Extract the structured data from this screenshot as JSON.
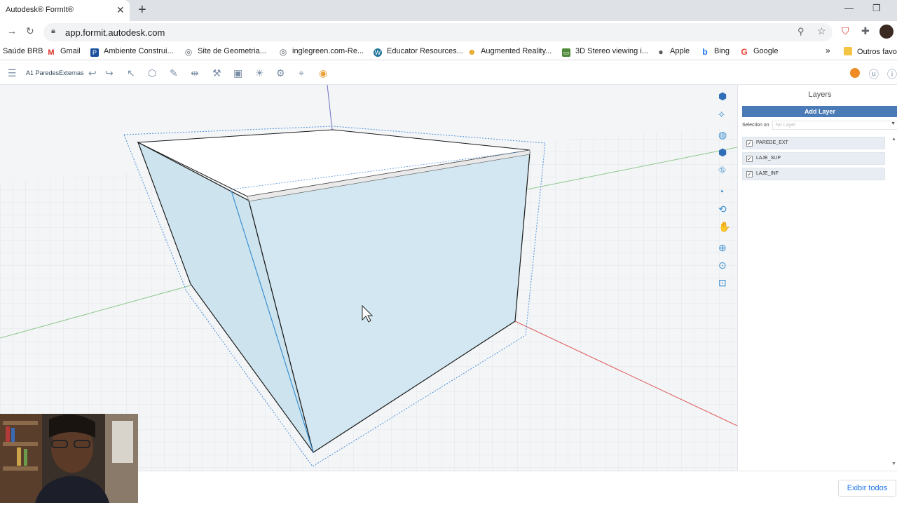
{
  "browser": {
    "tab_title": "Autodesk® FormIt®",
    "tab_close": "✕",
    "new_tab": "+",
    "url": "app.formit.autodesk.com",
    "bookmarks": [
      {
        "label": "Saúde BRB",
        "icon": "none"
      },
      {
        "label": "Gmail",
        "icon": "gmail-icon",
        "glyph": "M",
        "color": "#d93025"
      },
      {
        "label": "Ambiente Construi...",
        "icon": "p-icon",
        "glyph": "P",
        "color": "#1a4f9c"
      },
      {
        "label": "Site de Geometria...",
        "icon": "globe-icon",
        "glyph": "◎",
        "color": "#5f6368"
      },
      {
        "label": "inglegreen.com-Re...",
        "icon": "globe-icon",
        "glyph": "◎",
        "color": "#5f6368"
      },
      {
        "label": "Educator Resources...",
        "icon": "wordpress-icon",
        "glyph": "W",
        "color": "#21759b"
      },
      {
        "label": "Augmented Reality...",
        "icon": "ar-icon",
        "glyph": "☻",
        "color": "#e3a21a"
      },
      {
        "label": "3D Stereo viewing i...",
        "icon": "image-icon",
        "glyph": "▭",
        "color": "#4f8a3a"
      },
      {
        "label": "Apple",
        "icon": "apple-icon",
        "glyph": "",
        "color": "#555"
      },
      {
        "label": "Bing",
        "icon": "bing-icon",
        "glyph": "b",
        "color": "#1a73e8"
      },
      {
        "label": "Google",
        "icon": "google-icon",
        "glyph": "G",
        "color": "#ea4335"
      }
    ],
    "bookmarks_overflow": "»",
    "other_bookmarks": "Outros favo"
  },
  "formit": {
    "sketch_name": "A1  ParedesExternas"
  },
  "layers_panel": {
    "title": "Layers",
    "add_layer": "Add Layer",
    "selection_label": "Selection on",
    "selection_value": "No Layer",
    "layers": [
      {
        "name": "PAREDE_EXT",
        "checked": "✓"
      },
      {
        "name": "LAJE_SUP",
        "checked": "✓"
      },
      {
        "name": "LAJE_INF",
        "checked": "✓"
      }
    ]
  },
  "bottom": {
    "show_all": "Exibir todos"
  },
  "colors": {
    "accent": "#4a7bb7",
    "wall_fill": "#cfe5f0",
    "nav_icon": "#3b8fd0"
  }
}
